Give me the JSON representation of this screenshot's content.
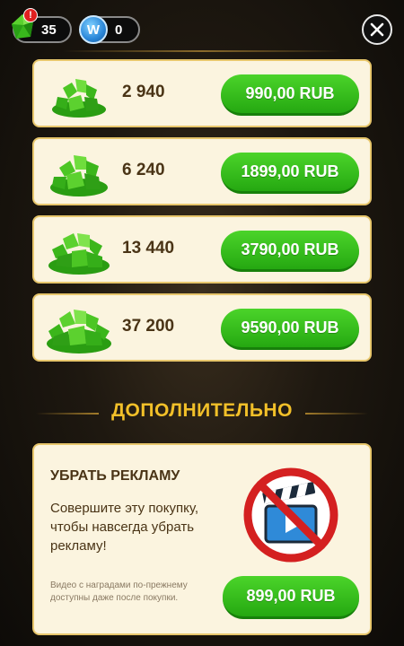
{
  "header": {
    "gems_count": "35",
    "alert_badge": "!",
    "w_currency_letter": "W",
    "w_count": "0"
  },
  "offers": [
    {
      "amount": "2 940",
      "price": "990,00 RUB"
    },
    {
      "amount": "6 240",
      "price": "1899,00 RUB"
    },
    {
      "amount": "13 440",
      "price": "3790,00 RUB"
    },
    {
      "amount": "37 200",
      "price": "9590,00 RUB"
    }
  ],
  "extra": {
    "section_title": "ДОПОЛНИТЕЛЬНО",
    "remove_ads": {
      "title": "УБРАТЬ РЕКЛАМУ",
      "description": "Совершите эту покупку, чтобы навсегда убрать рекламу!",
      "note": "Видео с наградами по-прежнему доступны даже после покупки.",
      "price": "899,00 RUB"
    }
  },
  "colors": {
    "button_green": "#2fb81a",
    "card_bg": "#fbf4df",
    "card_border": "#e7c66c",
    "title_gold": "#f2c029",
    "text_brown": "#4a3416"
  },
  "icons": {
    "gem": "green-gem-icon",
    "w_coin": "w-coin-icon",
    "close": "close-icon",
    "no_ads": "no-ads-icon"
  }
}
